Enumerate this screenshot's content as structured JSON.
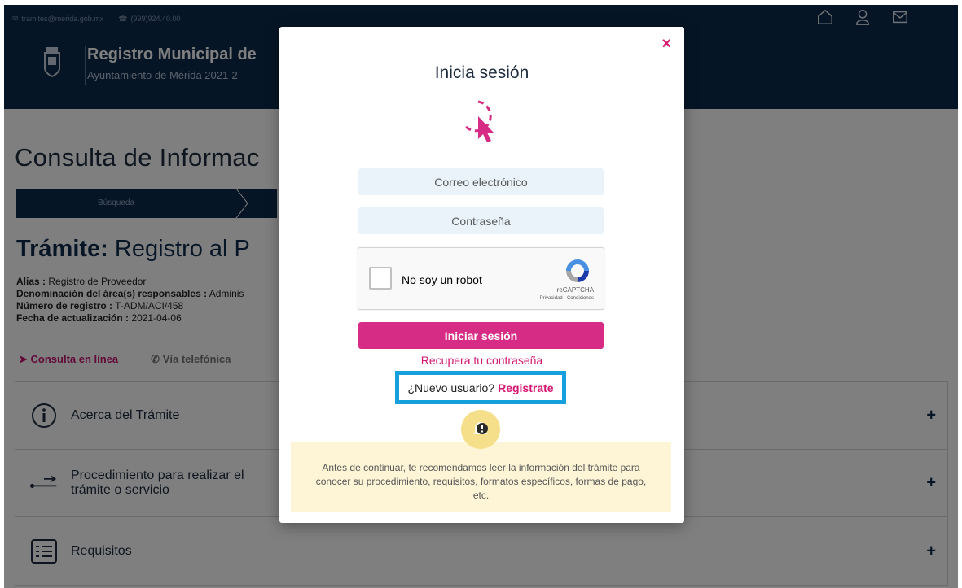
{
  "topbar": {
    "email": "tramites@merida.gob.mx",
    "phone": "(999)924.40.00",
    "icons": [
      "home-icon",
      "user-icon",
      "mail-icon"
    ]
  },
  "brand": {
    "title": "Registro Municipal de",
    "subtitle": "Ayuntamiento de Mérida 2021-2"
  },
  "page": {
    "heading": "Consulta de Informac",
    "step": "Búsqueda",
    "tramite_prefix": "Trámite:",
    "tramite_name": "Registro al P",
    "meta": {
      "alias_label": "Alias :",
      "alias_value": "Registro de Proveedor",
      "area_label": "Denominación del área(s) responsables :",
      "area_value": "Adminis",
      "numero_label": "Número de registro :",
      "numero_value": "T-ADM/ACI/458",
      "fecha_label": "Fecha de actualización :",
      "fecha_value": "2021-04-06"
    },
    "modes": {
      "online": "Consulta en línea",
      "phone": "Vía telefónica"
    },
    "accordion": [
      {
        "label": "Acerca del Trámite"
      },
      {
        "label_line1": "Procedimiento para realizar el",
        "label_line2": "trámite o servicio"
      },
      {
        "label": "Requisitos"
      }
    ],
    "plus": "+"
  },
  "modal": {
    "close": "×",
    "title": "Inicia sesión",
    "email_placeholder": "Correo electrónico",
    "password_placeholder": "Contraseña",
    "captcha": {
      "label": "No soy un robot",
      "brand": "reCAPTCHA",
      "links": "Privacidad - Condiciones"
    },
    "login_button": "Iniciar sesión",
    "recover_link": "Recupera tu contraseña",
    "new_user_text": "¿Nuevo usuario?",
    "register_link": "Registrate",
    "notice": "Antes de continuar, te recomendamos leer la información del trámite para conocer su procedimiento, requisitos, formatos específicos, formas de pago, etc."
  },
  "colors": {
    "navy": "#0d2a4b",
    "magenta": "#d62c86",
    "highlight": "#16a0de",
    "notice_bg": "#fdf5d6"
  }
}
